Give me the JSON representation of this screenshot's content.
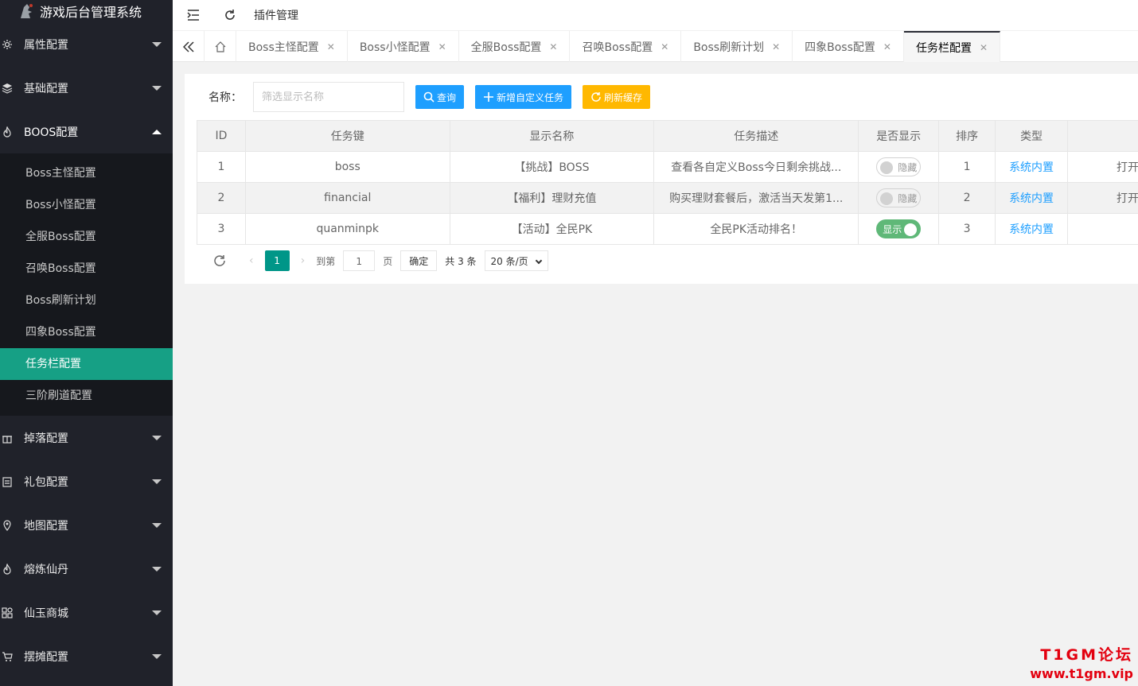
{
  "app": {
    "title": "游戏后台管理系统"
  },
  "sidebar": {
    "groups_top": [
      {
        "label": "属性配置",
        "icon": "gear-icon"
      },
      {
        "label": "基础配置",
        "icon": "layers-icon"
      },
      {
        "label": "BOOS配置",
        "icon": "fire-icon",
        "expanded": true
      }
    ],
    "sub_items": [
      {
        "label": "Boss主怪配置"
      },
      {
        "label": "Boss小怪配置"
      },
      {
        "label": "全服Boss配置"
      },
      {
        "label": "召唤Boss配置"
      },
      {
        "label": "Boss刷新计划"
      },
      {
        "label": "四象Boss配置"
      },
      {
        "label": "任务栏配置",
        "active": true
      },
      {
        "label": "三阶刷道配置"
      }
    ],
    "groups_bottom": [
      {
        "label": "掉落配置",
        "icon": "gift-icon"
      },
      {
        "label": "礼包配置",
        "icon": "clipboard-icon"
      },
      {
        "label": "地图配置",
        "icon": "location-icon"
      },
      {
        "label": "熔炼仙丹",
        "icon": "fire-icon"
      },
      {
        "label": "仙玉商城",
        "icon": "apps-icon"
      },
      {
        "label": "摆摊配置",
        "icon": "cart-icon"
      }
    ]
  },
  "topbar": {
    "title": "插件管理"
  },
  "tabs": [
    {
      "label": "Boss主怪配置"
    },
    {
      "label": "Boss小怪配置"
    },
    {
      "label": "全服Boss配置"
    },
    {
      "label": "召唤Boss配置"
    },
    {
      "label": "Boss刷新计划"
    },
    {
      "label": "四象Boss配置"
    },
    {
      "label": "任务栏配置",
      "active": true
    }
  ],
  "search": {
    "label": "名称：",
    "placeholder": "筛选显示名称",
    "query_button": "查询",
    "add_button": "新增自定义任务",
    "refresh_button": "刷新缓存"
  },
  "table": {
    "headers": [
      "ID",
      "任务键",
      "显示名称",
      "任务描述",
      "是否显示",
      "排序",
      "类型",
      ""
    ],
    "rows": [
      {
        "id": "1",
        "key": "boss",
        "name": "【挑战】BOSS",
        "desc": "查看各自定义Boss今日剩余挑战...",
        "visible": false,
        "visible_label": "隐藏",
        "sort": "1",
        "type": "系统内置",
        "action": "打开"
      },
      {
        "id": "2",
        "key": "financial",
        "name": "【福利】理财充值",
        "desc": "购买理财套餐后，激活当天发第1...",
        "visible": false,
        "visible_label": "隐藏",
        "sort": "2",
        "type": "系统内置",
        "action": "打开"
      },
      {
        "id": "3",
        "key": "quanminpk",
        "name": "【活动】全民PK",
        "desc": "全民PK活动排名！",
        "visible": true,
        "visible_label": "显示",
        "sort": "3",
        "type": "系统内置",
        "action": ""
      }
    ]
  },
  "pager": {
    "current": "1",
    "goto_label": "到第",
    "goto_value": "1",
    "page_suffix": "页",
    "confirm": "确定",
    "total": "共 3 条",
    "per_page": "20 条/页"
  },
  "watermark": {
    "line1": "T1GM论坛",
    "line2": "www.t1gm.vip"
  },
  "colors": {
    "sidebar_bg": "#20222a",
    "active": "#16a085",
    "blue": "#1e9fff",
    "orange": "#ffb800",
    "switch_on": "#5fb878",
    "watermark": "#e3000f"
  }
}
